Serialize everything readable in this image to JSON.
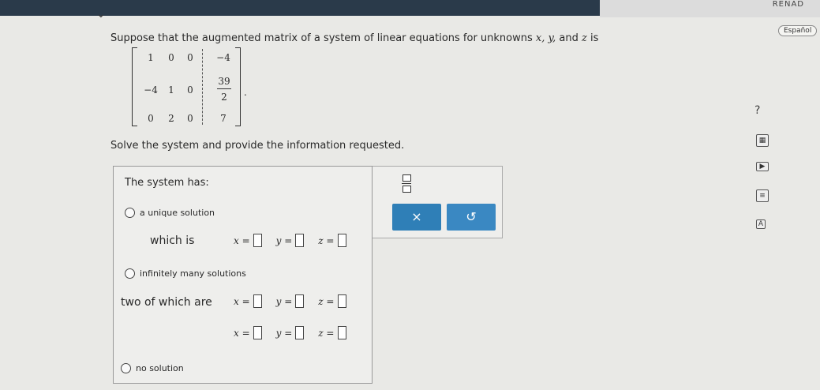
{
  "header": {
    "right_text": "RENAD"
  },
  "language_button": "Español",
  "question": {
    "prompt_prefix": "Suppose that the augmented matrix of a system of linear equations for unknowns ",
    "prompt_vars": "x, y,",
    "prompt_mid": " and ",
    "prompt_z": "z",
    "prompt_suffix": " is",
    "matrix": {
      "r1": [
        "1",
        "0",
        "0",
        "−4"
      ],
      "r2": [
        "−4",
        "1",
        "0"
      ],
      "r2_frac_num": "39",
      "r2_frac_den": "2",
      "r3": [
        "0",
        "2",
        "0",
        "7"
      ],
      "end_dot": "."
    },
    "instruction": "Solve the system and provide the information requested."
  },
  "help_icon": "?",
  "answer_panel": {
    "title": "The system has:",
    "option_unique": "a unique solution",
    "which_is": "which is",
    "option_infinite": "infinitely many solutions",
    "two_of_which": "two of which are",
    "option_none": "no solution",
    "x_label": "x =",
    "y_label": "y =",
    "z_label": "z ="
  },
  "tools": {
    "clear_label": "×",
    "undo_label": "↺"
  }
}
